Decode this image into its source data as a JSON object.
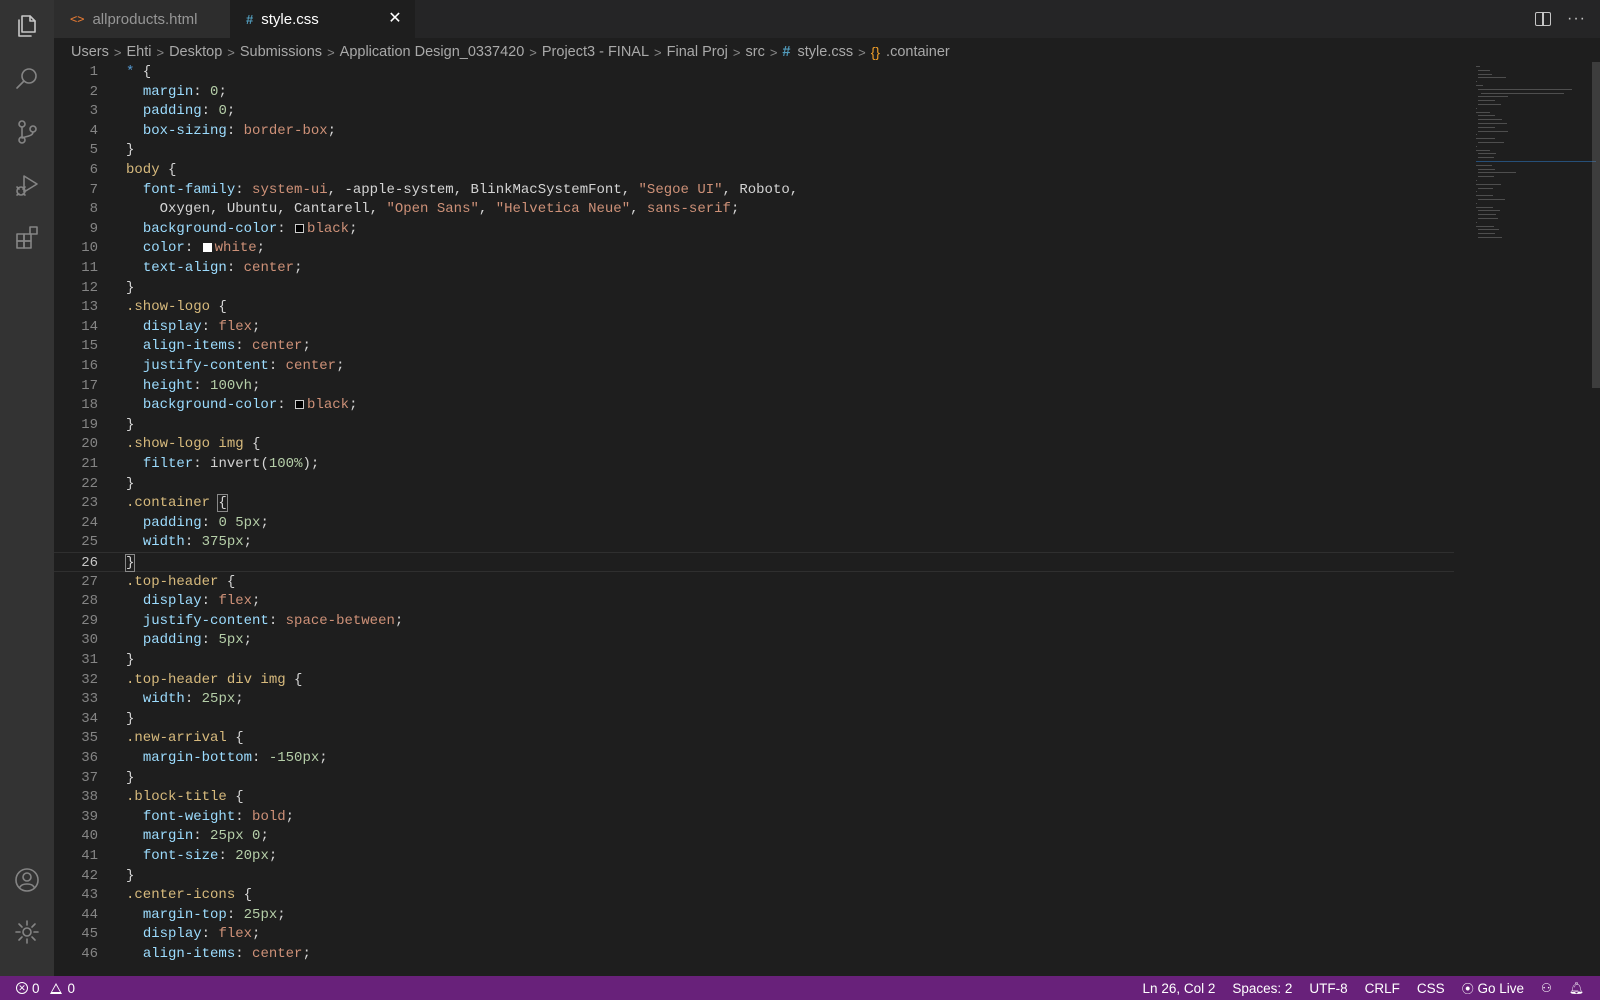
{
  "tabs": [
    {
      "icon": "<>",
      "label": "allproducts.html",
      "active": false
    },
    {
      "icon": "#",
      "label": "style.css",
      "active": true,
      "close": "✕"
    }
  ],
  "tab_actions": {
    "more": "···"
  },
  "breadcrumb": {
    "items": [
      "Users",
      "Ehti",
      "Desktop",
      "Submissions",
      "Application Design_0337420",
      "Project3 - FINAL",
      "Final Proj",
      "src"
    ],
    "file_icon": "#",
    "file": "style.css",
    "symbol_icon": "{}",
    "symbol": ".container",
    "separator": ">"
  },
  "editor": {
    "line_numbers": [
      "1",
      "2",
      "3",
      "4",
      "5",
      "6",
      "7",
      "8",
      "9",
      "10",
      "11",
      "12",
      "13",
      "14",
      "15",
      "16",
      "17",
      "18",
      "19",
      "20",
      "21",
      "22",
      "23",
      "24",
      "25",
      "26",
      "27",
      "28",
      "29",
      "30",
      "31",
      "32",
      "33",
      "34",
      "35",
      "36",
      "37",
      "38",
      "39",
      "40",
      "41",
      "42",
      "43",
      "44",
      "45",
      "46"
    ],
    "current_line": 26,
    "lines": [
      [
        [
          "star",
          "*"
        ],
        [
          "p",
          " {"
        ]
      ],
      [
        [
          "p",
          "  "
        ],
        [
          "prop",
          "margin"
        ],
        [
          "p",
          ": "
        ],
        [
          "num",
          "0"
        ],
        [
          "p",
          ";"
        ]
      ],
      [
        [
          "p",
          "  "
        ],
        [
          "prop",
          "padding"
        ],
        [
          "p",
          ": "
        ],
        [
          "num",
          "0"
        ],
        [
          "p",
          ";"
        ]
      ],
      [
        [
          "p",
          "  "
        ],
        [
          "prop",
          "box-sizing"
        ],
        [
          "p",
          ": "
        ],
        [
          "val",
          "border-box"
        ],
        [
          "p",
          ";"
        ]
      ],
      [
        [
          "p",
          "}"
        ]
      ],
      [
        [
          "sel",
          "body"
        ],
        [
          "p",
          " {"
        ]
      ],
      [
        [
          "p",
          "  "
        ],
        [
          "prop",
          "font-family"
        ],
        [
          "p",
          ": "
        ],
        [
          "val",
          "system-ui"
        ],
        [
          "p",
          ", -apple-system, BlinkMacSystemFont, "
        ],
        [
          "val",
          "\"Segoe UI\""
        ],
        [
          "p",
          ", Roboto,"
        ]
      ],
      [
        [
          "p",
          "    Oxygen, Ubuntu, Cantarell, "
        ],
        [
          "val",
          "\"Open Sans\""
        ],
        [
          "p",
          ", "
        ],
        [
          "val",
          "\"Helvetica Neue\""
        ],
        [
          "p",
          ", "
        ],
        [
          "val",
          "sans-serif"
        ],
        [
          "p",
          ";"
        ]
      ],
      [
        [
          "p",
          "  "
        ],
        [
          "prop",
          "background-color"
        ],
        [
          "p",
          ": "
        ],
        [
          "swatch",
          "black"
        ],
        [
          "val",
          "black"
        ],
        [
          "p",
          ";"
        ]
      ],
      [
        [
          "p",
          "  "
        ],
        [
          "prop",
          "color"
        ],
        [
          "p",
          ": "
        ],
        [
          "swatch",
          "white"
        ],
        [
          "val",
          "white"
        ],
        [
          "p",
          ";"
        ]
      ],
      [
        [
          "p",
          "  "
        ],
        [
          "prop",
          "text-align"
        ],
        [
          "p",
          ": "
        ],
        [
          "val",
          "center"
        ],
        [
          "p",
          ";"
        ]
      ],
      [
        [
          "p",
          "}"
        ]
      ],
      [
        [
          "sel",
          ".show-logo"
        ],
        [
          "p",
          " {"
        ]
      ],
      [
        [
          "p",
          "  "
        ],
        [
          "prop",
          "display"
        ],
        [
          "p",
          ": "
        ],
        [
          "val",
          "flex"
        ],
        [
          "p",
          ";"
        ]
      ],
      [
        [
          "p",
          "  "
        ],
        [
          "prop",
          "align-items"
        ],
        [
          "p",
          ": "
        ],
        [
          "val",
          "center"
        ],
        [
          "p",
          ";"
        ]
      ],
      [
        [
          "p",
          "  "
        ],
        [
          "prop",
          "justify-content"
        ],
        [
          "p",
          ": "
        ],
        [
          "val",
          "center"
        ],
        [
          "p",
          ";"
        ]
      ],
      [
        [
          "p",
          "  "
        ],
        [
          "prop",
          "height"
        ],
        [
          "p",
          ": "
        ],
        [
          "num",
          "100vh"
        ],
        [
          "p",
          ";"
        ]
      ],
      [
        [
          "p",
          "  "
        ],
        [
          "prop",
          "background-color"
        ],
        [
          "p",
          ": "
        ],
        [
          "swatch",
          "black"
        ],
        [
          "val",
          "black"
        ],
        [
          "p",
          ";"
        ]
      ],
      [
        [
          "p",
          "}"
        ]
      ],
      [
        [
          "sel",
          ".show-logo img"
        ],
        [
          "p",
          " {"
        ]
      ],
      [
        [
          "p",
          "  "
        ],
        [
          "prop",
          "filter"
        ],
        [
          "p",
          ": invert("
        ],
        [
          "num",
          "100%"
        ],
        [
          "p",
          ");"
        ]
      ],
      [
        [
          "p",
          "}"
        ]
      ],
      [
        [
          "sel",
          ".container"
        ],
        [
          "p",
          " "
        ],
        [
          "bracket",
          "{"
        ]
      ],
      [
        [
          "p",
          "  "
        ],
        [
          "prop",
          "padding"
        ],
        [
          "p",
          ": "
        ],
        [
          "num",
          "0 5px"
        ],
        [
          "p",
          ";"
        ]
      ],
      [
        [
          "p",
          "  "
        ],
        [
          "prop",
          "width"
        ],
        [
          "p",
          ": "
        ],
        [
          "num",
          "375px"
        ],
        [
          "p",
          ";"
        ]
      ],
      [
        [
          "bracket",
          "}"
        ]
      ],
      [
        [
          "sel",
          ".top-header"
        ],
        [
          "p",
          " {"
        ]
      ],
      [
        [
          "p",
          "  "
        ],
        [
          "prop",
          "display"
        ],
        [
          "p",
          ": "
        ],
        [
          "val",
          "flex"
        ],
        [
          "p",
          ";"
        ]
      ],
      [
        [
          "p",
          "  "
        ],
        [
          "prop",
          "justify-content"
        ],
        [
          "p",
          ": "
        ],
        [
          "val",
          "space-between"
        ],
        [
          "p",
          ";"
        ]
      ],
      [
        [
          "p",
          "  "
        ],
        [
          "prop",
          "padding"
        ],
        [
          "p",
          ": "
        ],
        [
          "num",
          "5px"
        ],
        [
          "p",
          ";"
        ]
      ],
      [
        [
          "p",
          "}"
        ]
      ],
      [
        [
          "sel",
          ".top-header div img"
        ],
        [
          "p",
          " {"
        ]
      ],
      [
        [
          "p",
          "  "
        ],
        [
          "prop",
          "width"
        ],
        [
          "p",
          ": "
        ],
        [
          "num",
          "25px"
        ],
        [
          "p",
          ";"
        ]
      ],
      [
        [
          "p",
          "}"
        ]
      ],
      [
        [
          "sel",
          ".new-arrival"
        ],
        [
          "p",
          " {"
        ]
      ],
      [
        [
          "p",
          "  "
        ],
        [
          "prop",
          "margin-bottom"
        ],
        [
          "p",
          ": "
        ],
        [
          "num",
          "-150px"
        ],
        [
          "p",
          ";"
        ]
      ],
      [
        [
          "p",
          "}"
        ]
      ],
      [
        [
          "sel",
          ".block-title"
        ],
        [
          "p",
          " {"
        ]
      ],
      [
        [
          "p",
          "  "
        ],
        [
          "prop",
          "font-weight"
        ],
        [
          "p",
          ": "
        ],
        [
          "val",
          "bold"
        ],
        [
          "p",
          ";"
        ]
      ],
      [
        [
          "p",
          "  "
        ],
        [
          "prop",
          "margin"
        ],
        [
          "p",
          ": "
        ],
        [
          "num",
          "25px 0"
        ],
        [
          "p",
          ";"
        ]
      ],
      [
        [
          "p",
          "  "
        ],
        [
          "prop",
          "font-size"
        ],
        [
          "p",
          ": "
        ],
        [
          "num",
          "20px"
        ],
        [
          "p",
          ";"
        ]
      ],
      [
        [
          "p",
          "}"
        ]
      ],
      [
        [
          "sel",
          ".center-icons"
        ],
        [
          "p",
          " {"
        ]
      ],
      [
        [
          "p",
          "  "
        ],
        [
          "prop",
          "margin-top"
        ],
        [
          "p",
          ": "
        ],
        [
          "num",
          "25px"
        ],
        [
          "p",
          ";"
        ]
      ],
      [
        [
          "p",
          "  "
        ],
        [
          "prop",
          "display"
        ],
        [
          "p",
          ": "
        ],
        [
          "val",
          "flex"
        ],
        [
          "p",
          ";"
        ]
      ],
      [
        [
          "p",
          "  "
        ],
        [
          "prop",
          "align-items"
        ],
        [
          "p",
          ": "
        ],
        [
          "val",
          "center"
        ],
        [
          "p",
          ";"
        ]
      ]
    ]
  },
  "statusbar": {
    "errors": "0",
    "warnings": "0",
    "position": "Ln 26, Col 2",
    "spaces": "Spaces: 2",
    "encoding": "UTF-8",
    "eol": "CRLF",
    "language": "CSS",
    "go_live": "Go Live"
  },
  "colors": {
    "activity_bar": "#333333",
    "editor_bg": "#1e1e1e",
    "statusbar": "#68217a",
    "selector": "#d7ba7d",
    "property": "#9cdcfe",
    "value": "#ce9178",
    "number": "#b5cea8"
  },
  "icons": {
    "activity": [
      "files-icon",
      "search-icon",
      "source-control-icon",
      "run-debug-icon",
      "extensions-icon",
      "account-icon",
      "settings-gear-icon"
    ]
  }
}
